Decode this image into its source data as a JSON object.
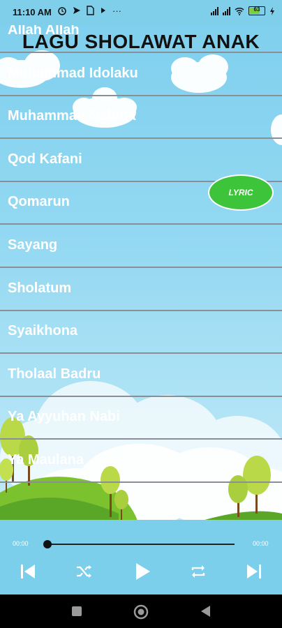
{
  "status_bar": {
    "time": "11:10 AM",
    "icons": [
      "alarm-icon",
      "send-icon",
      "sim-icon",
      "play-icon",
      "more-icon"
    ],
    "battery_level": "63"
  },
  "app": {
    "title": "LAGU SHOLAWAT ANAK",
    "songs": [
      "Allah Allah",
      "Muhammad Idolaku",
      "Muhammad Nabina",
      "Qod Kafani",
      "Qomarun",
      "Sayang",
      "Sholatum",
      "Syaikhona",
      "Tholaal Badru",
      "Ya Ayyuhan Nabi",
      "Ya Maulana"
    ],
    "lyric_button": "LYRIC"
  },
  "player": {
    "current_time": "00:00",
    "total_time": "00:00",
    "progress": 0,
    "controls": [
      "previous-icon",
      "shuffle-icon",
      "play-icon",
      "repeat-icon",
      "next-icon"
    ]
  },
  "colors": {
    "sky_top": "#7fd0ee",
    "player_bg": "#7ccfeb",
    "lyric_green": "#3ec43b",
    "hill_green": "#6fbf2a"
  }
}
